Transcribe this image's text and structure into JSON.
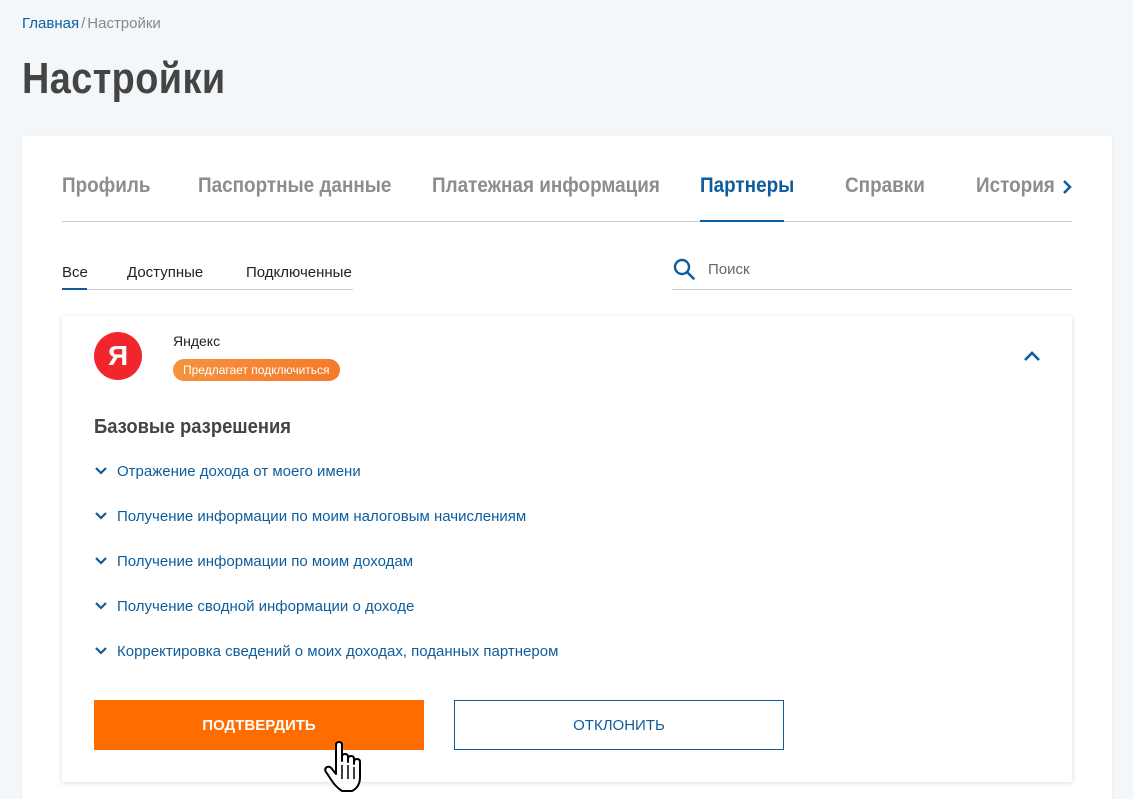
{
  "breadcrumb": {
    "home": "Главная",
    "separator": "/",
    "current": "Настройки"
  },
  "page_title": "Настройки",
  "tabs": [
    {
      "label": "Профиль"
    },
    {
      "label": "Паспортные данные"
    },
    {
      "label": "Платежная информация"
    },
    {
      "label": "Партнеры",
      "active": true
    },
    {
      "label": "Справки"
    },
    {
      "label": "История"
    }
  ],
  "subtabs": [
    {
      "label": "Все",
      "active": true
    },
    {
      "label": "Доступные"
    },
    {
      "label": "Подключенные"
    }
  ],
  "search": {
    "placeholder": "Поиск",
    "value": ""
  },
  "partner": {
    "logo_letter": "Я",
    "name": "Яндекс",
    "status_badge": "Предлагает подключиться",
    "permissions_title": "Базовые разрешения",
    "permissions": [
      {
        "label": "Отражение дохода от моего имени"
      },
      {
        "label": "Получение информации по моим налоговым начислениям"
      },
      {
        "label": "Получение информации по моим доходам"
      },
      {
        "label": "Получение сводной информации о доходе"
      },
      {
        "label": "Корректировка сведений о моих доходах, поданных партнером"
      }
    ],
    "confirm_label": "ПОДТВЕРДИТЬ",
    "reject_label": "ОТКЛОНИТЬ"
  },
  "colors": {
    "accent": "#0d5d9e",
    "confirm_button": "#ff6c00",
    "badge": "#f47a2b",
    "yandex_red": "#f0262c"
  }
}
